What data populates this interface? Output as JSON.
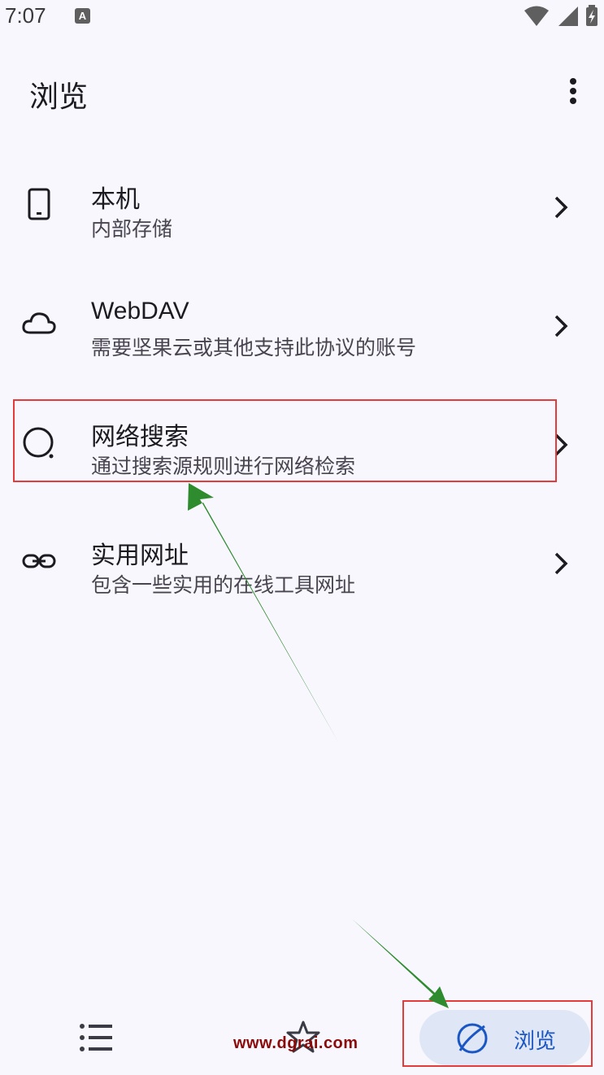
{
  "status_bar": {
    "time": "7:07",
    "a_icon_label": "A"
  },
  "top_bar": {
    "title": "浏览",
    "more_icon": "more-vertical-icon"
  },
  "list": [
    {
      "title": "本机",
      "subtitle": "内部存储",
      "icon": "phone-icon"
    },
    {
      "title": "WebDAV",
      "subtitle": "需要坚果云或其他支持此协议的账号",
      "icon": "cloud-icon"
    },
    {
      "title": "网络搜索",
      "subtitle": "通过搜索源规则进行网络检索",
      "icon": "search-circle-icon"
    },
    {
      "title": "实用网址",
      "subtitle": "包含一些实用的在线工具网址",
      "icon": "link-icon"
    }
  ],
  "bottom_nav": {
    "items": [
      {
        "icon": "list-icon"
      },
      {
        "icon": "star-icon"
      },
      {
        "label": "浏览",
        "icon": "compass-icon",
        "active": true
      }
    ]
  },
  "watermark": "www.dgrai.com",
  "colors": {
    "background": "#f8f7fd",
    "accent": "#1a56c4",
    "highlight": "#e53b3b",
    "arrow": "#2e8b2e"
  }
}
